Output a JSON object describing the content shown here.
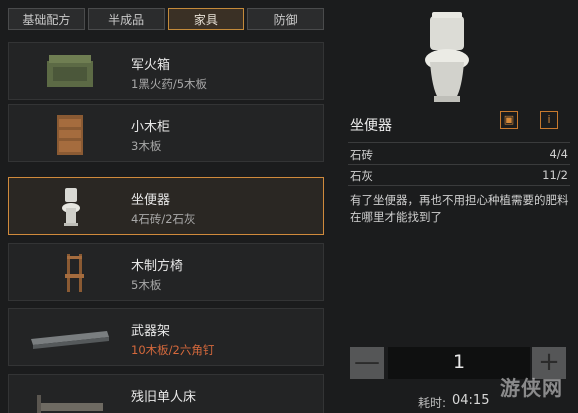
{
  "tabs": [
    {
      "label": "基础配方",
      "active": false
    },
    {
      "label": "半成品",
      "active": false
    },
    {
      "label": "家具",
      "active": true
    },
    {
      "label": "防御",
      "active": false
    }
  ],
  "items": [
    {
      "name": "军火箱",
      "req": "1黑火药/5木板",
      "icon": "ammo-crate-icon",
      "selected": false,
      "warn": false
    },
    {
      "name": "小木柜",
      "req": "3木板",
      "icon": "wooden-cabinet-icon",
      "selected": false,
      "warn": false
    },
    {
      "name": "坐便器",
      "req": "4石砖/2石灰",
      "icon": "toilet-icon",
      "selected": true,
      "warn": false
    },
    {
      "name": "木制方椅",
      "req": "5木板",
      "icon": "wooden-chair-icon",
      "selected": false,
      "warn": false
    },
    {
      "name": "武器架",
      "req": "10木板/2六角钉",
      "icon": "weapon-rack-icon",
      "selected": false,
      "warn": true
    },
    {
      "name": "残旧单人床",
      "req": "",
      "icon": "old-bed-icon",
      "selected": false,
      "warn": false
    }
  ],
  "detail": {
    "title": "坐便器",
    "blueprint_icon": "blueprint-icon",
    "info_icon": "info-icon",
    "materials": [
      {
        "name": "石砖",
        "count": "4/4"
      },
      {
        "name": "石灰",
        "count": "11/2"
      }
    ],
    "description": "有了坐便器，再也不用担心种植需要的肥料在哪里才能找到了"
  },
  "craft": {
    "quantity": "1",
    "minus": "—",
    "plus": "+",
    "time_label": "耗时:",
    "time_value": "04:15"
  },
  "watermark": "游侠网",
  "colors": {
    "accent": "#d08a3c",
    "warn": "#d6693c",
    "background": "#1b1c1d"
  }
}
